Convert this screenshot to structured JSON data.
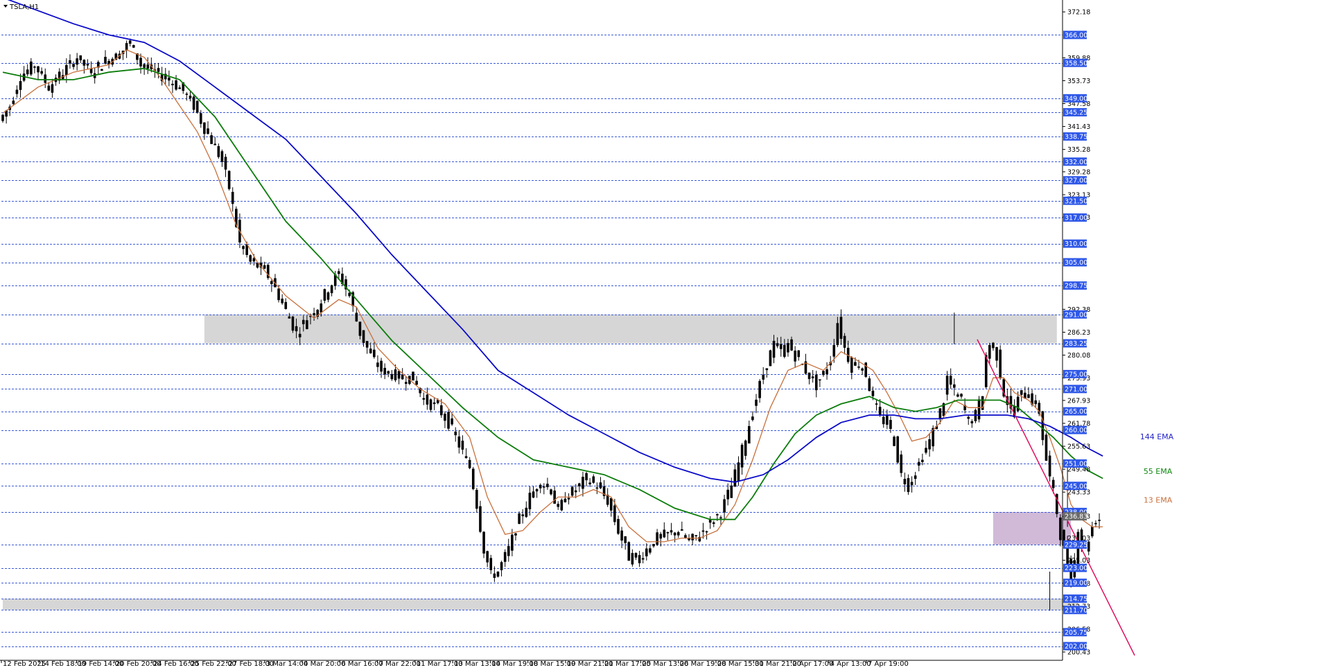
{
  "chart_data": {
    "type": "line",
    "symbol": "TSLA,H1",
    "price_axis": {
      "ylim": [
        198.2,
        375.0
      ],
      "ticks": [
        372.18,
        359.88,
        353.73,
        347.58,
        341.43,
        335.28,
        329.28,
        323.13,
        317.13,
        292.38,
        286.23,
        280.08,
        273.93,
        267.93,
        261.78,
        255.63,
        249.48,
        243.33,
        236.83,
        231.03,
        225.03,
        218.88,
        212.73,
        206.58,
        200.43
      ],
      "level_tags": [
        "366.00",
        "358.50",
        "349.00",
        "345.25",
        "338.75",
        "332.00",
        "327.00",
        "321.50",
        "317.00",
        "310.00",
        "305.00",
        "298.75",
        "291.00",
        "283.25",
        "275.00",
        "271.00",
        "265.00",
        "260.00",
        "251.00",
        "245.00",
        "238.00",
        "236.83",
        "229.25",
        "223.00",
        "219.00",
        "214.75",
        "211.70",
        "205.75",
        "202.00"
      ]
    },
    "horizontal_levels": [
      366.0,
      358.5,
      349.0,
      345.25,
      338.75,
      332.0,
      327.0,
      321.5,
      317.0,
      310.0,
      305.0,
      298.75,
      291.0,
      283.25,
      275.0,
      271.0,
      265.0,
      260.0,
      251.0,
      245.0,
      238.0,
      229.25,
      223.0,
      219.0,
      214.75,
      211.7,
      205.75,
      202.0
    ],
    "time_labels": [
      "12 Feb 2025",
      "14 Feb 18:00",
      "19 Feb 14:00",
      "20 Feb 20:00",
      "24 Feb 16:00",
      "25 Feb 22:00",
      "27 Feb 18:00",
      "3 Mar 14:00",
      "4 Mar 20:00",
      "6 Mar 16:00",
      "7 Mar 22:00",
      "11 Mar 17:00",
      "13 Mar 13:00",
      "14 Mar 19:00",
      "18 Mar 15:00",
      "19 Mar 21:00",
      "21 Mar 17:00",
      "25 Mar 13:00",
      "26 Mar 19:00",
      "28 Mar 15:00",
      "31 Mar 21:00",
      "2 Apr 17:00",
      "4 Apr 13:00",
      "7 Apr 19:00"
    ],
    "bar_count": 300,
    "price_path": [
      [
        0,
        343
      ],
      [
        3,
        347
      ],
      [
        6,
        355
      ],
      [
        10,
        358
      ],
      [
        14,
        352
      ],
      [
        18,
        356
      ],
      [
        22,
        360
      ],
      [
        26,
        356
      ],
      [
        30,
        359
      ],
      [
        34,
        361
      ],
      [
        37,
        364
      ],
      [
        40,
        358
      ],
      [
        44,
        356
      ],
      [
        48,
        354
      ],
      [
        52,
        351
      ],
      [
        55,
        347
      ],
      [
        58,
        341
      ],
      [
        61,
        336
      ],
      [
        63,
        332
      ],
      [
        65,
        325
      ],
      [
        68,
        310
      ],
      [
        71,
        305
      ],
      [
        75,
        303
      ],
      [
        78,
        298
      ],
      [
        81,
        292
      ],
      [
        84,
        286
      ],
      [
        87,
        290
      ],
      [
        90,
        293
      ],
      [
        93,
        298
      ],
      [
        96,
        302
      ],
      [
        99,
        296
      ],
      [
        102,
        286
      ],
      [
        105,
        280
      ],
      [
        108,
        276
      ],
      [
        111,
        275
      ],
      [
        114,
        274
      ],
      [
        117,
        274
      ],
      [
        120,
        268
      ],
      [
        124,
        266
      ],
      [
        127,
        262
      ],
      [
        130,
        256
      ],
      [
        133,
        250
      ],
      [
        135,
        240
      ],
      [
        137,
        228
      ],
      [
        139,
        221
      ],
      [
        141,
        222
      ],
      [
        144,
        228
      ],
      [
        147,
        236
      ],
      [
        150,
        242
      ],
      [
        153,
        246
      ],
      [
        156,
        244
      ],
      [
        158,
        238
      ],
      [
        160,
        242
      ],
      [
        163,
        244
      ],
      [
        166,
        247
      ],
      [
        169,
        245
      ],
      [
        172,
        241
      ],
      [
        175,
        233
      ],
      [
        178,
        226
      ],
      [
        180,
        225
      ],
      [
        183,
        228
      ],
      [
        186,
        231
      ],
      [
        189,
        232
      ],
      [
        192,
        233
      ],
      [
        195,
        230
      ],
      [
        198,
        232
      ],
      [
        201,
        235
      ],
      [
        204,
        238
      ],
      [
        207,
        245
      ],
      [
        209,
        251
      ],
      [
        211,
        258
      ],
      [
        213,
        265
      ],
      [
        215,
        272
      ],
      [
        217,
        278
      ],
      [
        219,
        283
      ],
      [
        221,
        281
      ],
      [
        223,
        283
      ],
      [
        225,
        280
      ],
      [
        228,
        276
      ],
      [
        231,
        272
      ],
      [
        233,
        275
      ],
      [
        235,
        279
      ],
      [
        237,
        289
      ],
      [
        239,
        282
      ],
      [
        241,
        277
      ],
      [
        243,
        278
      ],
      [
        245,
        275
      ],
      [
        247,
        268
      ],
      [
        249,
        263
      ],
      [
        251,
        262
      ],
      [
        253,
        257
      ],
      [
        255,
        248
      ],
      [
        257,
        245
      ],
      [
        259,
        249
      ],
      [
        261,
        253
      ],
      [
        263,
        257
      ],
      [
        265,
        262
      ],
      [
        267,
        268
      ],
      [
        268,
        274
      ],
      [
        270,
        270
      ],
      [
        272,
        268
      ],
      [
        274,
        262
      ],
      [
        276,
        264
      ],
      [
        278,
        270
      ],
      [
        279,
        280
      ],
      [
        280,
        283
      ],
      [
        282,
        280
      ],
      [
        284,
        270
      ],
      [
        286,
        265
      ],
      [
        288,
        268
      ],
      [
        290,
        271
      ],
      [
        292,
        268
      ],
      [
        294,
        265
      ],
      [
        295,
        258
      ],
      [
        296,
        252
      ],
      [
        297,
        247
      ],
      [
        298,
        243
      ],
      [
        299,
        238
      ],
      [
        300,
        232
      ],
      [
        301,
        228
      ],
      [
        302,
        224
      ],
      [
        303,
        220
      ],
      [
        304,
        225
      ],
      [
        305,
        234
      ],
      [
        306,
        230
      ],
      [
        307,
        228
      ],
      [
        308,
        231
      ],
      [
        309,
        234
      ],
      [
        310,
        236
      ]
    ],
    "series": [
      {
        "name": "13 EMA",
        "color": "#c8703c",
        "values": [
          [
            0,
            345
          ],
          [
            10,
            352
          ],
          [
            20,
            356
          ],
          [
            30,
            358
          ],
          [
            35,
            362
          ],
          [
            40,
            360
          ],
          [
            45,
            354
          ],
          [
            50,
            347
          ],
          [
            55,
            340
          ],
          [
            60,
            330
          ],
          [
            66,
            315
          ],
          [
            72,
            305
          ],
          [
            80,
            296
          ],
          [
            88,
            290
          ],
          [
            95,
            295
          ],
          [
            100,
            293
          ],
          [
            106,
            282
          ],
          [
            112,
            276
          ],
          [
            118,
            271
          ],
          [
            125,
            267
          ],
          [
            132,
            258
          ],
          [
            137,
            242
          ],
          [
            142,
            232
          ],
          [
            147,
            233
          ],
          [
            152,
            238
          ],
          [
            157,
            242
          ],
          [
            162,
            242
          ],
          [
            167,
            244
          ],
          [
            172,
            242
          ],
          [
            177,
            234
          ],
          [
            182,
            230
          ],
          [
            187,
            230
          ],
          [
            192,
            231
          ],
          [
            197,
            231
          ],
          [
            202,
            233
          ],
          [
            207,
            240
          ],
          [
            212,
            252
          ],
          [
            217,
            266
          ],
          [
            222,
            276
          ],
          [
            227,
            278
          ],
          [
            232,
            276
          ],
          [
            237,
            281
          ],
          [
            241,
            279
          ],
          [
            246,
            276
          ],
          [
            250,
            270
          ],
          [
            254,
            263
          ],
          [
            257,
            257
          ],
          [
            261,
            258
          ],
          [
            265,
            262
          ],
          [
            269,
            268
          ],
          [
            273,
            266
          ],
          [
            277,
            266
          ],
          [
            280,
            274
          ],
          [
            283,
            274
          ],
          [
            286,
            270
          ],
          [
            290,
            268
          ],
          [
            293,
            265
          ],
          [
            296,
            258
          ],
          [
            299,
            250
          ],
          [
            302,
            240
          ],
          [
            305,
            236
          ],
          [
            308,
            234
          ],
          [
            311,
            234
          ]
        ]
      },
      {
        "name": "55 EMA",
        "color": "#0b7d0b",
        "values": [
          [
            0,
            356
          ],
          [
            10,
            354
          ],
          [
            20,
            354
          ],
          [
            30,
            356
          ],
          [
            40,
            357
          ],
          [
            50,
            354
          ],
          [
            60,
            344
          ],
          [
            70,
            330
          ],
          [
            80,
            316
          ],
          [
            90,
            306
          ],
          [
            100,
            295
          ],
          [
            110,
            284
          ],
          [
            120,
            275
          ],
          [
            130,
            266
          ],
          [
            140,
            258
          ],
          [
            150,
            252
          ],
          [
            160,
            250
          ],
          [
            170,
            248
          ],
          [
            180,
            244
          ],
          [
            190,
            239
          ],
          [
            200,
            236
          ],
          [
            207,
            236
          ],
          [
            212,
            242
          ],
          [
            218,
            251
          ],
          [
            224,
            259
          ],
          [
            230,
            264
          ],
          [
            237,
            267
          ],
          [
            245,
            269
          ],
          [
            252,
            266
          ],
          [
            258,
            265
          ],
          [
            264,
            266
          ],
          [
            270,
            268
          ],
          [
            276,
            268
          ],
          [
            282,
            268
          ],
          [
            287,
            266
          ],
          [
            292,
            262
          ],
          [
            297,
            258
          ],
          [
            302,
            253
          ],
          [
            307,
            249
          ],
          [
            311,
            247
          ]
        ]
      },
      {
        "name": "144 EMA",
        "color": "#0a0ac8",
        "values": [
          [
            0,
            376
          ],
          [
            20,
            369
          ],
          [
            30,
            366
          ],
          [
            40,
            364
          ],
          [
            50,
            359
          ],
          [
            60,
            352
          ],
          [
            70,
            345
          ],
          [
            80,
            338
          ],
          [
            90,
            328
          ],
          [
            100,
            318
          ],
          [
            110,
            307
          ],
          [
            120,
            297
          ],
          [
            130,
            287
          ],
          [
            140,
            276
          ],
          [
            150,
            270
          ],
          [
            160,
            264
          ],
          [
            170,
            259
          ],
          [
            180,
            254
          ],
          [
            190,
            250
          ],
          [
            200,
            247
          ],
          [
            207,
            246
          ],
          [
            215,
            248
          ],
          [
            222,
            252
          ],
          [
            230,
            258
          ],
          [
            237,
            262
          ],
          [
            245,
            264
          ],
          [
            252,
            264
          ],
          [
            258,
            263
          ],
          [
            265,
            263
          ],
          [
            272,
            264
          ],
          [
            278,
            264
          ],
          [
            284,
            264
          ],
          [
            290,
            263
          ],
          [
            296,
            261
          ],
          [
            302,
            258
          ],
          [
            307,
            255
          ],
          [
            311,
            253
          ]
        ]
      }
    ],
    "ema_labels": [
      {
        "text": "144 EMA",
        "color": "#2323c8"
      },
      {
        "text": "55 EMA",
        "color": "#118811"
      },
      {
        "text": "13 EMA",
        "color": "#c8703c"
      }
    ],
    "zones": [
      {
        "name": "resistance",
        "from_bar": 57,
        "to_bar": 298,
        "price_high": 291.0,
        "price_low": 283.25,
        "color": "#d4d4d4"
      },
      {
        "name": "support",
        "from_bar": 0,
        "to_bar": 304,
        "price_high": 214.75,
        "price_low": 211.7,
        "color": "#d4d4d4"
      },
      {
        "name": "current",
        "from_bar": 280,
        "to_bar": 302,
        "price_high": 238.0,
        "price_low": 229.25,
        "color": "#cdb6d6"
      }
    ],
    "trendline": {
      "color": "#e0115f",
      "from": [
        275.5,
        284.3
      ],
      "to": [
        320,
        199.5
      ]
    },
    "grid": false,
    "colors": {
      "candle": "#000000",
      "level_line": "#3a5ad8",
      "tag_bg": "#2f58e8",
      "tag_last_bg": "#6a6a6a"
    }
  }
}
